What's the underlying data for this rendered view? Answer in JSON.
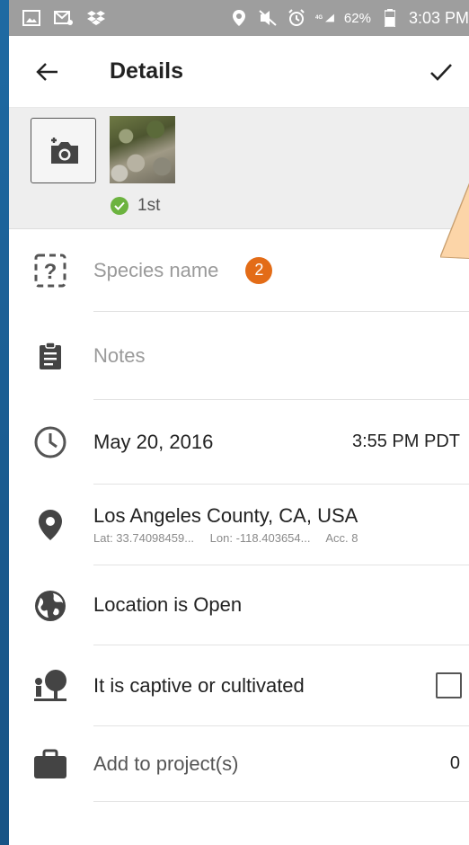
{
  "statusbar": {
    "battery_pct": "62%",
    "time": "3:03 PM"
  },
  "toolbar": {
    "title": "Details"
  },
  "photos": {
    "first_label": "1st"
  },
  "rows": {
    "species": {
      "placeholder": "Species name",
      "badge": "2"
    },
    "notes": {
      "placeholder": "Notes"
    },
    "datetime": {
      "date": "May 20, 2016",
      "time": "3:55 PM PDT"
    },
    "location": {
      "name": "Los Angeles County, CA, USA",
      "lat": "Lat: 33.74098459...",
      "lon": "Lon: -118.403654...",
      "acc": "Acc. 8"
    },
    "geoprivacy": {
      "label": "Location is Open"
    },
    "captive": {
      "label": "It is captive or cultivated",
      "checked": false
    },
    "projects": {
      "label": "Add to project(s)",
      "count": "0"
    }
  },
  "colors": {
    "badge": "#e36c17",
    "check_green": "#6cb33f",
    "callout_fill": "#fcd5a8",
    "status_bar": "#9e9e9e"
  }
}
